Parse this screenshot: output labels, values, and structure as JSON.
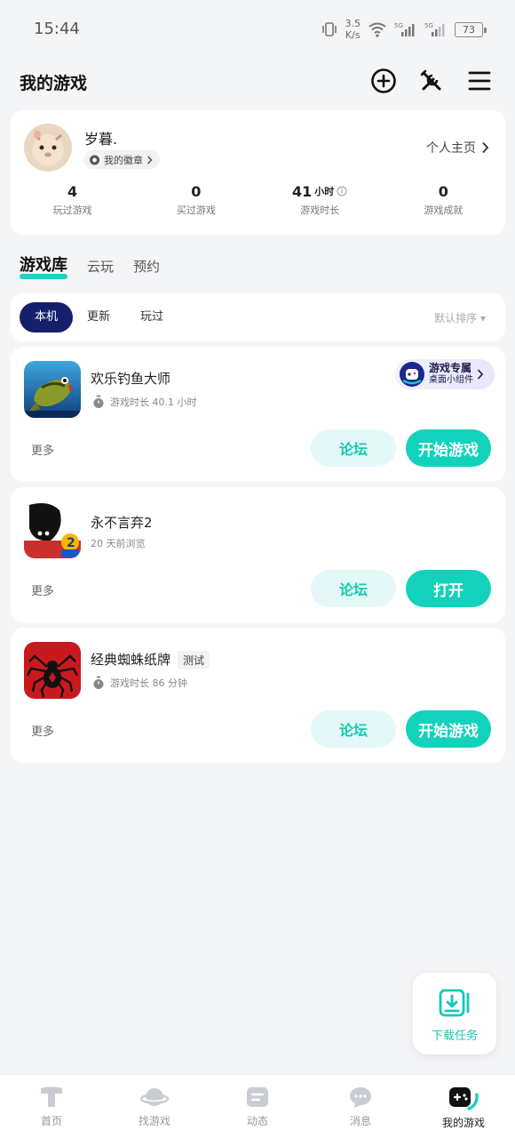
{
  "status_bar": {
    "time": "15:44",
    "speed_value": "3.5",
    "speed_unit": "K/s",
    "battery": "73"
  },
  "header": {
    "title": "我的游戏"
  },
  "profile": {
    "username": "岁暮.",
    "badge_label": "我的徽章",
    "home_link": "个人主页",
    "stats": [
      {
        "value": "4",
        "unit": "",
        "label": "玩过游戏"
      },
      {
        "value": "0",
        "unit": "",
        "label": "买过游戏"
      },
      {
        "value": "41",
        "unit": "小时",
        "label": "游戏时长"
      },
      {
        "value": "0",
        "unit": "",
        "label": "游戏成就"
      }
    ]
  },
  "tabs": [
    "游戏库",
    "云玩",
    "预约"
  ],
  "filters": {
    "chips": [
      "本机",
      "更新",
      "玩过"
    ],
    "sort": "默认排序 ▾"
  },
  "games": [
    {
      "name": "欢乐钓鱼大师",
      "tag": "",
      "sub": "游戏时长 40.1 小时",
      "more": "更多",
      "forum": "论坛",
      "action": "开始游戏",
      "widget_title": "游戏专属",
      "widget_sub": "桌面小组件"
    },
    {
      "name": "永不言弃2",
      "tag": "",
      "sub": "20 天前浏览",
      "more": "更多",
      "forum": "论坛",
      "action": "打开"
    },
    {
      "name": "经典蜘蛛纸牌",
      "tag": "测试",
      "sub": "游戏时长 86 分钟",
      "more": "更多",
      "forum": "论坛",
      "action": "开始游戏"
    }
  ],
  "download_float": {
    "label": "下载任务"
  },
  "bottom_nav": [
    {
      "label": "首页",
      "icon": "home-icon"
    },
    {
      "label": "找游戏",
      "icon": "planet-icon"
    },
    {
      "label": "动态",
      "icon": "feed-icon"
    },
    {
      "label": "消息",
      "icon": "message-icon"
    },
    {
      "label": "我的游戏",
      "icon": "gamepad-icon"
    }
  ],
  "colors": {
    "accent": "#13d2bc",
    "navy": "#14206b",
    "background": "#f4f5f7"
  }
}
